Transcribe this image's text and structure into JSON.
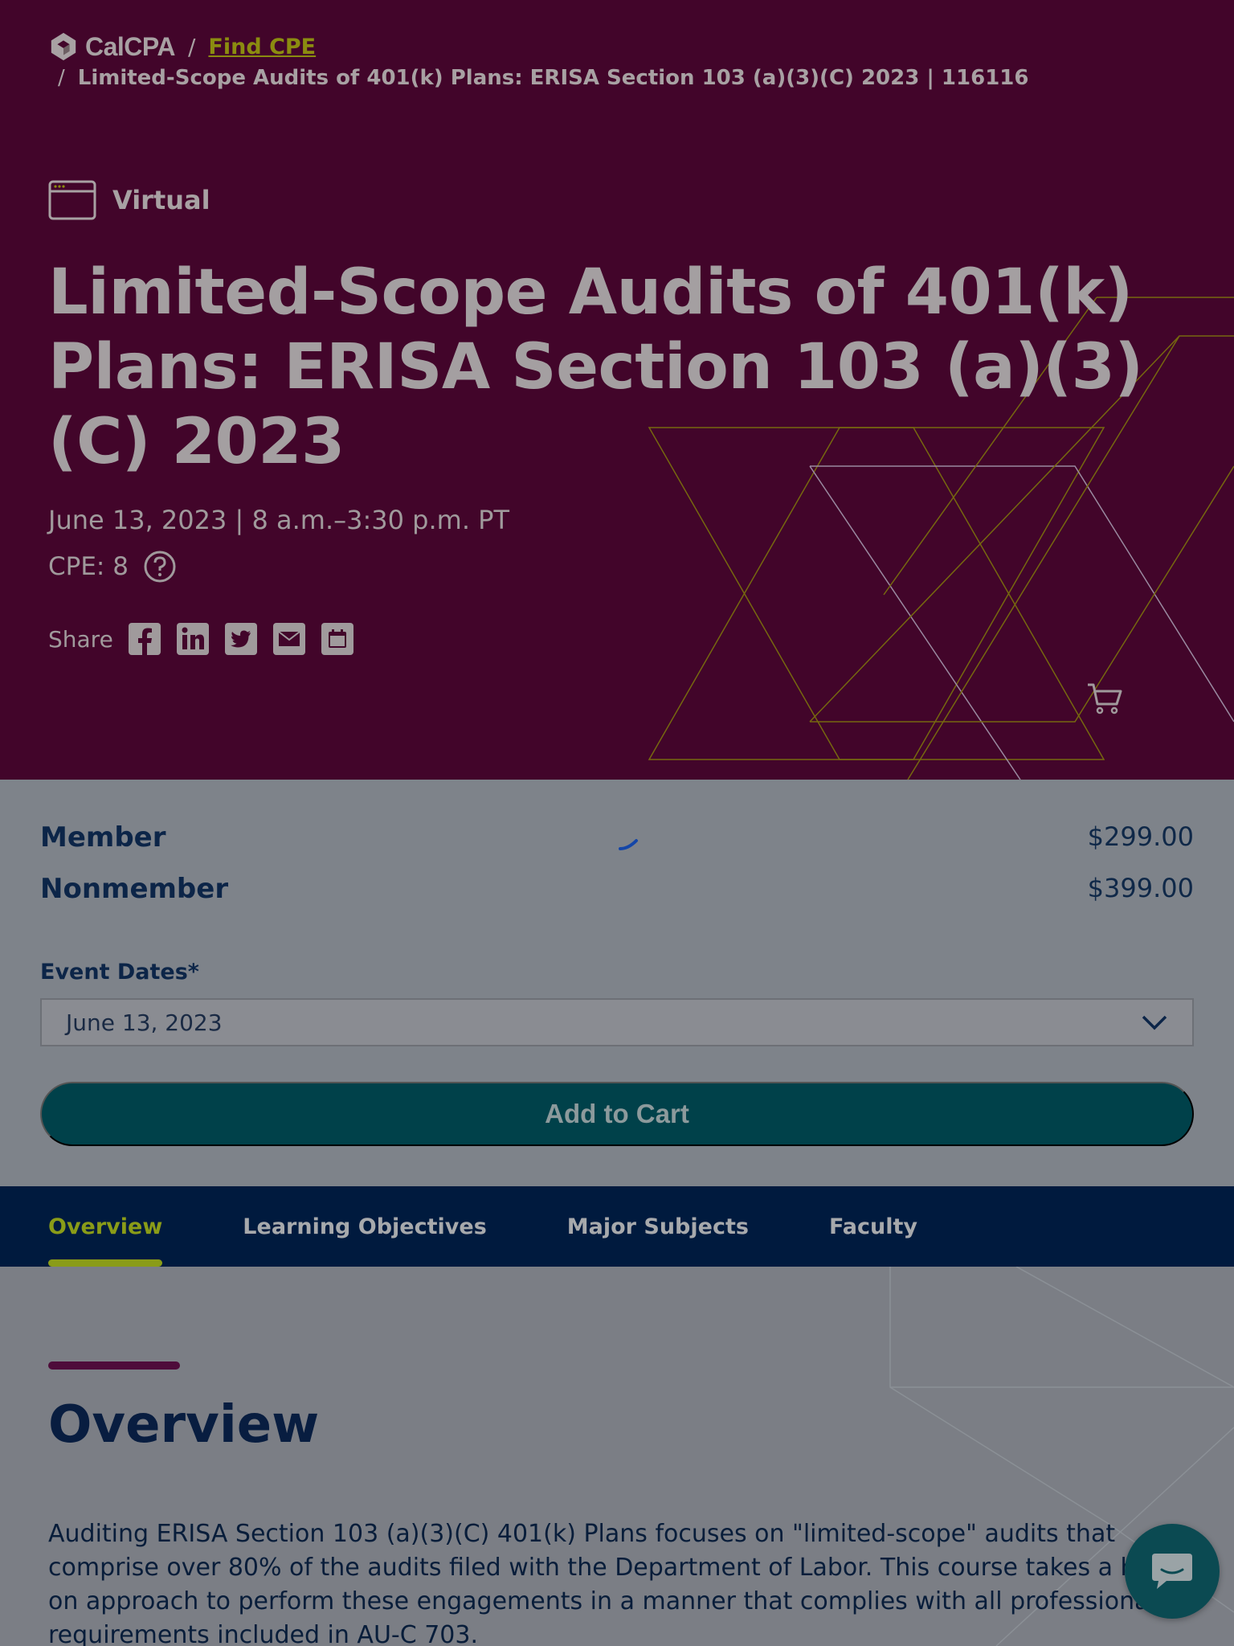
{
  "breadcrumb": {
    "logo_text": "CalCPA",
    "separator": "/",
    "link": "Find CPE",
    "current": "Limited-Scope Audits of 401(k) Plans: ERISA Section 103 (a)(3)(C) 2023 | 116116"
  },
  "event": {
    "format": "Virtual",
    "title": "Limited-Scope Audits of 401(k) Plans: ERISA Section 103 (a)(3)(C) 2023",
    "date_time": "June 13, 2023 | 8 a.m.–3:30 p.m. PT",
    "cpe": "CPE: 8"
  },
  "share": {
    "label": "Share",
    "icons": [
      "facebook-icon",
      "linkedin-icon",
      "twitter-icon",
      "email-icon",
      "calendar-icon"
    ]
  },
  "pricing": {
    "member_label": "Member",
    "member_price": "$299.00",
    "nonmember_label": "Nonmember",
    "nonmember_price": "$399.00",
    "event_dates_label": "Event Dates*",
    "selected_date": "June 13, 2023",
    "add_to_cart": "Add to Cart"
  },
  "tabs": [
    {
      "label": "Overview",
      "active": true
    },
    {
      "label": "Learning Objectives",
      "active": false
    },
    {
      "label": "Major Subjects",
      "active": false
    },
    {
      "label": "Faculty",
      "active": false
    }
  ],
  "overview": {
    "heading": "Overview",
    "body": "Auditing ERISA Section 103 (a)(3)(C) 401(k) Plans focuses on \"limited-scope\" audits that comprise over 80% of the audits filed with the Department of Labor. This course takes a hands-on approach to perform these engagements in a manner that complies with all professional requirements included in AU-C 703."
  },
  "colors": {
    "hero_bg": "#42052a",
    "accent_lime": "#8a9c18",
    "nav_bg": "#001a3e",
    "button_bg": "#00414a",
    "overlay_bg": "#7b7e85"
  }
}
